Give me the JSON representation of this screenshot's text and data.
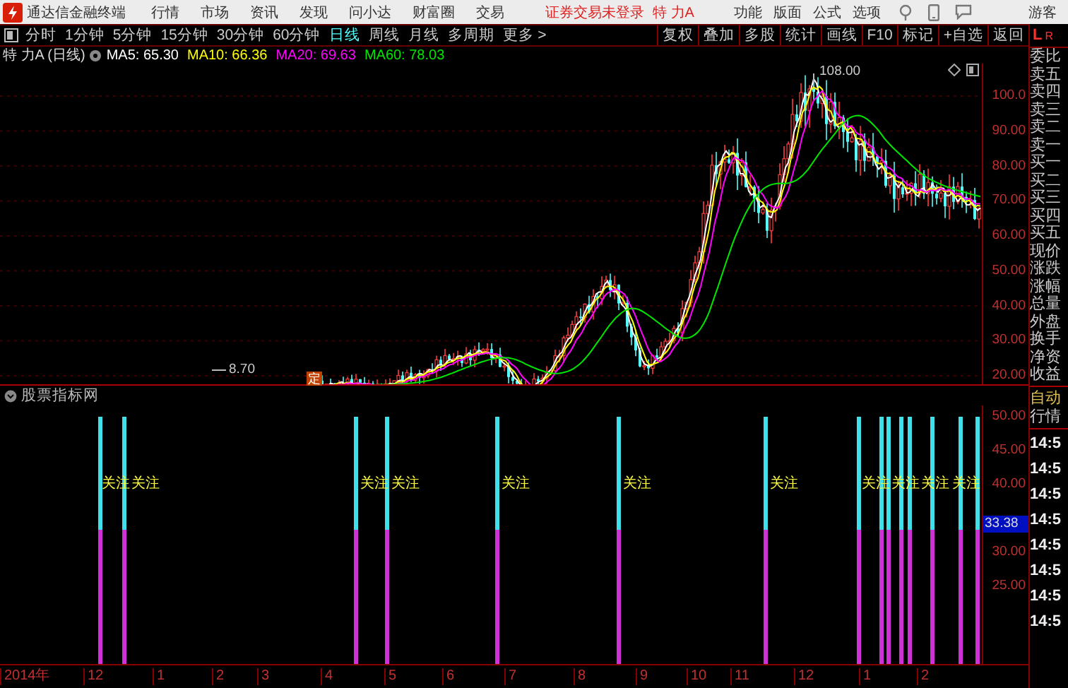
{
  "menubar": {
    "app_title": "通达信金融终端",
    "menus": [
      "行情",
      "市场",
      "资讯",
      "发现",
      "问小达",
      "财富圈",
      "交易"
    ],
    "login_status": "证券交易未登录",
    "stock": "特 力A",
    "tools": [
      "功能",
      "版面",
      "公式",
      "选项"
    ],
    "user": "游客"
  },
  "toolbar": {
    "periods": [
      {
        "label": "分时",
        "selected": false
      },
      {
        "label": "1分钟",
        "selected": false
      },
      {
        "label": "5分钟",
        "selected": false
      },
      {
        "label": "15分钟",
        "selected": false
      },
      {
        "label": "30分钟",
        "selected": false
      },
      {
        "label": "60分钟",
        "selected": false
      },
      {
        "label": "日线",
        "selected": true
      },
      {
        "label": "周线",
        "selected": false
      },
      {
        "label": "月线",
        "selected": false
      },
      {
        "label": "多周期",
        "selected": false
      },
      {
        "label": "更多 >",
        "selected": false
      }
    ],
    "actions": [
      "复权",
      "叠加",
      "多股",
      "统计",
      "画线",
      "F10",
      "标记",
      "+自选",
      "返回"
    ]
  },
  "chart": {
    "title": "特 力A (日线)",
    "ma": [
      {
        "label": "MA5: 65.30",
        "color": "#ffffff"
      },
      {
        "label": "MA10: 66.36",
        "color": "#ffff00"
      },
      {
        "label": "MA20: 69.63",
        "color": "#ff00ff"
      },
      {
        "label": "MA60: 78.03",
        "color": "#00e600"
      }
    ],
    "y_axis": [
      "100.0",
      "90.00",
      "80.00",
      "70.00",
      "60.00",
      "50.00",
      "40.00",
      "30.00",
      "20.00"
    ],
    "high_label": "108.00",
    "low_label": "8.70",
    "marker": "定"
  },
  "indicator": {
    "name": "股票指标网",
    "y_axis": [
      "50.00",
      "45.00",
      "40.00",
      "30.00",
      "25.00"
    ],
    "current_value": "33.38",
    "signal_labels": [
      "关注",
      "关注",
      "关注",
      "关注",
      "关注",
      "关注",
      "关注",
      "关注",
      "关注",
      "关注",
      "关注"
    ]
  },
  "x_axis": [
    "2014年",
    "12",
    "1",
    "2",
    "3",
    "4",
    "5",
    "6",
    "7",
    "8",
    "9",
    "10",
    "11",
    "12",
    "1",
    "2"
  ],
  "side_panel": {
    "header": [
      "L",
      "R"
    ],
    "quote_labels": [
      "委比",
      "卖五",
      "卖四",
      "卖三",
      "卖二",
      "卖一",
      "买一",
      "买二",
      "买三",
      "买四",
      "买五",
      "现价",
      "涨跌",
      "涨幅",
      "总量",
      "外盘",
      "换手",
      "净资",
      "收益"
    ],
    "mode_labels": [
      "自动",
      "行情"
    ],
    "times": [
      "14:5",
      "14:5",
      "14:5",
      "14:5",
      "14:5",
      "14:5",
      "14:5",
      "14:5"
    ]
  }
}
